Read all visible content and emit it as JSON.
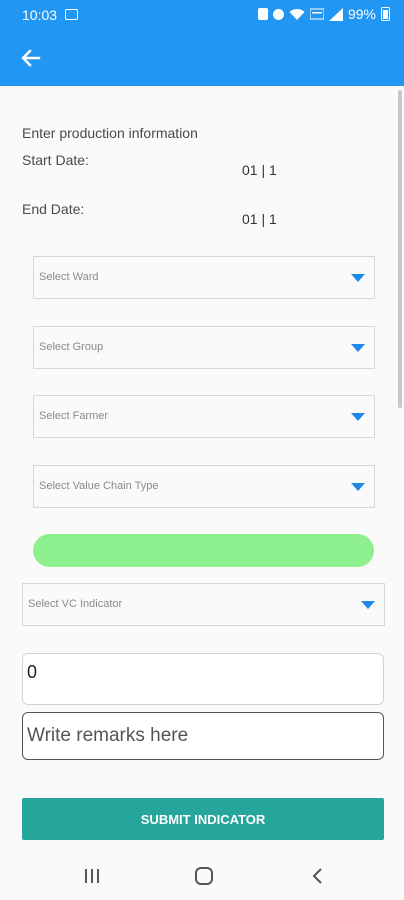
{
  "status_bar": {
    "time": "10:03",
    "battery_percent": "99%",
    "icons": [
      "image-icon",
      "alarm-icon",
      "battery-saver-icon",
      "wifi-icon",
      "volte-icon",
      "signal-icon",
      "battery-icon"
    ]
  },
  "app_bar": {
    "color": "#2196f3",
    "back_icon": "arrow-back-icon"
  },
  "form": {
    "intro": "Enter production information",
    "start_date_label": "Start Date:",
    "start_date_value": "01 | 1",
    "end_date_label": "End Date:",
    "end_date_value": "01 | 1",
    "ward_select": "Select Ward",
    "group_select": "Select Group",
    "farmer_select": "Select Farmer",
    "value_chain_select": "Select Value Chain Type",
    "vc_indicator_select": "Select VC Indicator",
    "quantity_value": "0",
    "remarks_placeholder": "Write remarks here",
    "submit_label": "SUBMIT INDICATOR",
    "progress_color": "#8def8d",
    "submit_color": "#26a69a"
  },
  "nav_bar": {
    "buttons": [
      "recents-icon",
      "home-icon",
      "back-icon"
    ]
  }
}
